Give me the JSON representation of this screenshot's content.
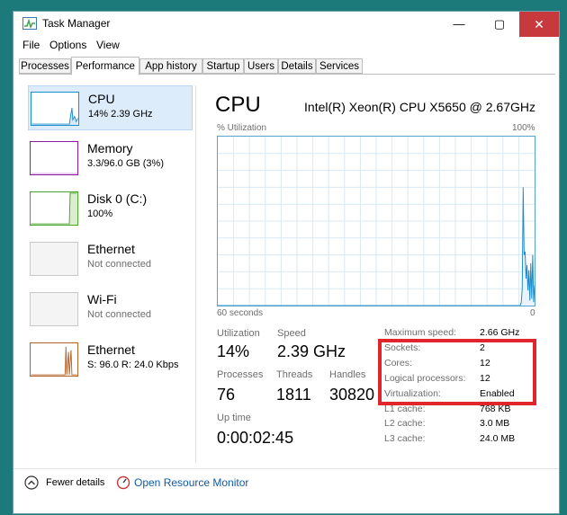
{
  "window": {
    "title": "Task Manager",
    "close_symbol": "✕",
    "minimize_symbol": "—",
    "maximize_symbol": "▢"
  },
  "menu": [
    "File",
    "Options",
    "View"
  ],
  "tabs": [
    "Processes",
    "Performance",
    "App history",
    "Startup",
    "Users",
    "Details",
    "Services"
  ],
  "active_tab": "Performance",
  "sidebar": [
    {
      "title": "CPU",
      "sub": "14%  2.39 GHz",
      "color": "#1f8dc9"
    },
    {
      "title": "Memory",
      "sub": "3.3/96.0 GB (3%)",
      "color": "#8b1aa3"
    },
    {
      "title": "Disk 0 (C:)",
      "sub": "100%",
      "color": "#4aa32b"
    },
    {
      "title": "Ethernet",
      "sub": "Not connected",
      "color": "#b5b5b5"
    },
    {
      "title": "Wi-Fi",
      "sub": "Not connected",
      "color": "#b5b5b5"
    },
    {
      "title": "Ethernet",
      "sub": "S: 96.0  R: 24.0 Kbps",
      "color": "#b4632a"
    }
  ],
  "main": {
    "title": "CPU",
    "cpu_name": "Intel(R) Xeon(R) CPU X5650 @ 2.67GHz",
    "graph_y_label": "% Utilization",
    "graph_y_max": "100%",
    "graph_x_left": "60 seconds",
    "graph_x_right": "0",
    "utilization_series": [
      0,
      0,
      0,
      0,
      0,
      0,
      0,
      0,
      0,
      0,
      0,
      0,
      0,
      0,
      0,
      0,
      0,
      0,
      0,
      0,
      0,
      0,
      0,
      0,
      0,
      0,
      0,
      0,
      0,
      0,
      0,
      0,
      0,
      0,
      0,
      0,
      0,
      0,
      0,
      0,
      0,
      0,
      0,
      0,
      0,
      0,
      0,
      0,
      0,
      0,
      0,
      0,
      0,
      0,
      0,
      0,
      0,
      0,
      0,
      0,
      0,
      0,
      0,
      0,
      0,
      0,
      0,
      0,
      0,
      0,
      0,
      0,
      0,
      0,
      0,
      0,
      0,
      0,
      0,
      0,
      0,
      0,
      0,
      0,
      0,
      0,
      0,
      0,
      0,
      0,
      0,
      0,
      0,
      0,
      0,
      0,
      0,
      0,
      0,
      0,
      0,
      0,
      0,
      0,
      0,
      0,
      0,
      0,
      0,
      0,
      0,
      0,
      0,
      0,
      0,
      0,
      0,
      0,
      0,
      0,
      0,
      0,
      0,
      0,
      0,
      0,
      0,
      0,
      0,
      0,
      0,
      0,
      0,
      0,
      0,
      0,
      0,
      0,
      0,
      0,
      0,
      0,
      0,
      0,
      0,
      0,
      0,
      0,
      0,
      0,
      0,
      0,
      0,
      0,
      0,
      0,
      0,
      0,
      0,
      0,
      0,
      0,
      0,
      0,
      0,
      0,
      0,
      0,
      0,
      0,
      0,
      0,
      0,
      0,
      0,
      0,
      0,
      0,
      0,
      0,
      0,
      0,
      0,
      0,
      0,
      0,
      0,
      0,
      0,
      0,
      0,
      0,
      0,
      0,
      0,
      0,
      0,
      0,
      0,
      0,
      0,
      0,
      0,
      0,
      0,
      0,
      0,
      0,
      0,
      0,
      0,
      0,
      0,
      0,
      0,
      0,
      0,
      0,
      0,
      0,
      0,
      0,
      0,
      0,
      0,
      0,
      0,
      0,
      0,
      0,
      0,
      0,
      0,
      0,
      0,
      0,
      0,
      0,
      0,
      0,
      0,
      0,
      0,
      0,
      0,
      0,
      0,
      0,
      0,
      0,
      0,
      0,
      0,
      0,
      0,
      0,
      0,
      0,
      0,
      0,
      0,
      0,
      0,
      0,
      0,
      0,
      0,
      0,
      0,
      0,
      0,
      0,
      0,
      0,
      0,
      0,
      0,
      0,
      0,
      0,
      0,
      0,
      0,
      0,
      0,
      0,
      0,
      0,
      0,
      0,
      0,
      0,
      0,
      0,
      0,
      0,
      0,
      0,
      0,
      0,
      0,
      0,
      0,
      0,
      0,
      0,
      0,
      0,
      0,
      0,
      0,
      0,
      0,
      0,
      0,
      0,
      0,
      0,
      0,
      2,
      10,
      70,
      30,
      32,
      16,
      24,
      9,
      21,
      3,
      25,
      4,
      30,
      2,
      12
    ],
    "stats": {
      "utilization_label": "Utilization",
      "utilization_value": "14%",
      "speed_label": "Speed",
      "speed_value": "2.39 GHz",
      "processes_label": "Processes",
      "processes_value": "76",
      "threads_label": "Threads",
      "threads_value": "1811",
      "handles_label": "Handles",
      "handles_value": "30820",
      "uptime_label": "Up time",
      "uptime_value": "0:00:02:45"
    },
    "specs": [
      {
        "label": "Maximum speed:",
        "value": "2.66 GHz"
      },
      {
        "label": "Sockets:",
        "value": "2"
      },
      {
        "label": "Cores:",
        "value": "12"
      },
      {
        "label": "Logical processors:",
        "value": "12"
      },
      {
        "label": "Virtualization:",
        "value": "Enabled"
      },
      {
        "label": "L1 cache:",
        "value": "768 KB"
      },
      {
        "label": "L2 cache:",
        "value": "3.0 MB"
      },
      {
        "label": "L3 cache:",
        "value": "24.0 MB"
      }
    ]
  },
  "footer": {
    "fewer_details": "Fewer details",
    "open_resource_monitor": "Open Resource Monitor"
  }
}
